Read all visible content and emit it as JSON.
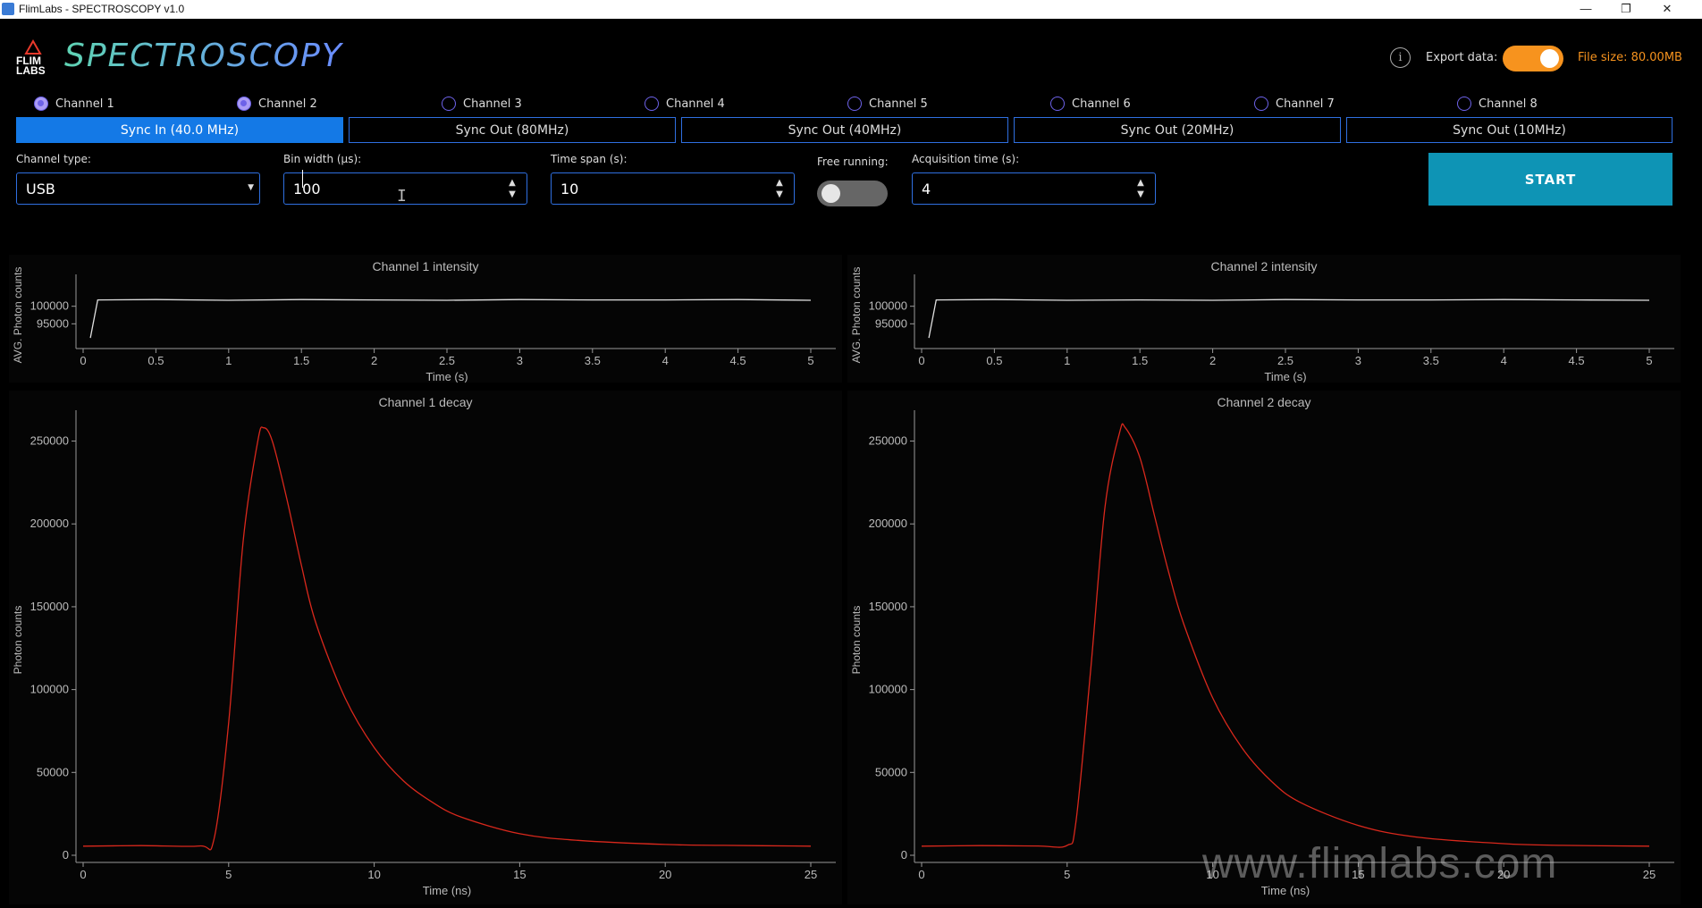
{
  "window": {
    "title": "FlimLabs - SPECTROSCOPY v1.0",
    "minimize": "—",
    "restore": "❐",
    "close": "✕"
  },
  "header": {
    "app_title": "SPECTROSCOPY",
    "export_label": "Export data:",
    "export_enabled": true,
    "file_size": "File size: 80.00MB",
    "info_glyph": "i"
  },
  "channels": [
    {
      "label": "Channel 1",
      "checked": true
    },
    {
      "label": "Channel 2",
      "checked": true
    },
    {
      "label": "Channel 3",
      "checked": false
    },
    {
      "label": "Channel 4",
      "checked": false
    },
    {
      "label": "Channel 5",
      "checked": false
    },
    {
      "label": "Channel 6",
      "checked": false
    },
    {
      "label": "Channel 7",
      "checked": false
    },
    {
      "label": "Channel 8",
      "checked": false
    }
  ],
  "sync": [
    {
      "label": "Sync In (40.0 MHz)",
      "active": true
    },
    {
      "label": "Sync Out (80MHz)",
      "active": false
    },
    {
      "label": "Sync Out (40MHz)",
      "active": false
    },
    {
      "label": "Sync Out (20MHz)",
      "active": false
    },
    {
      "label": "Sync Out (10MHz)",
      "active": false
    }
  ],
  "controls": {
    "channel_type_label": "Channel type:",
    "channel_type_value": "USB",
    "bin_width_label": "Bin width (µs):",
    "bin_width_value": "100",
    "time_span_label": "Time span (s):",
    "time_span_value": "10",
    "free_running_label": "Free running:",
    "free_running": false,
    "acq_time_label": "Acquisition time (s):",
    "acq_time_value": "4",
    "start_label": "START"
  },
  "colors": {
    "accent_blue": "#1479e6",
    "export_orange": "#f7931e",
    "start_teal": "#0e94b5",
    "decay_red": "#d9281c",
    "intensity_line": "#e0e0e0"
  },
  "watermark": "www.flimlabs.com",
  "chart_data": [
    {
      "type": "line",
      "title": "Channel 1 intensity",
      "xlabel": "Time (s)",
      "ylabel": "AVG. Photon counts",
      "xlim": [
        0,
        5
      ],
      "ylim": [
        90000,
        105000
      ],
      "xticks": [
        "0",
        "0.5",
        "1",
        "1.5",
        "2",
        "2.5",
        "3",
        "3.5",
        "4",
        "4.5",
        "5"
      ],
      "yticks": [
        "95000",
        "100000"
      ],
      "series": [
        {
          "x": [
            0.05,
            0.1,
            0.5,
            1,
            1.5,
            2,
            2.5,
            3,
            3.5,
            4,
            4.5,
            5
          ],
          "y": [
            91000,
            101800,
            101900,
            101700,
            101900,
            101800,
            101700,
            101900,
            101800,
            101800,
            101900,
            101700
          ]
        }
      ]
    },
    {
      "type": "line",
      "title": "Channel 2 intensity",
      "xlabel": "Time (s)",
      "ylabel": "AVG. Photon counts",
      "xlim": [
        0,
        5
      ],
      "ylim": [
        90000,
        105000
      ],
      "xticks": [
        "0",
        "0.5",
        "1",
        "1.5",
        "2",
        "2.5",
        "3",
        "3.5",
        "4",
        "4.5",
        "5"
      ],
      "yticks": [
        "95000",
        "100000"
      ],
      "series": [
        {
          "x": [
            0.05,
            0.1,
            0.5,
            1,
            1.5,
            2,
            2.5,
            3,
            3.5,
            4,
            4.5,
            5
          ],
          "y": [
            91000,
            101800,
            101900,
            101700,
            101800,
            101700,
            101900,
            101800,
            101800,
            101900,
            101800,
            101700
          ]
        }
      ]
    },
    {
      "type": "line",
      "title": "Channel 1 decay",
      "xlabel": "Time (ns)",
      "ylabel": "Photon counts",
      "xlim": [
        0,
        25
      ],
      "ylim": [
        0,
        260000
      ],
      "xticks": [
        "0",
        "5",
        "10",
        "15",
        "20",
        "25"
      ],
      "yticks": [
        "0",
        "50000",
        "100000",
        "150000",
        "200000",
        "250000"
      ],
      "series": [
        {
          "x": [
            0,
            2,
            4,
            4.5,
            5,
            5.5,
            6,
            6.2,
            6.5,
            7,
            7.5,
            8,
            9,
            10,
            11,
            12,
            13,
            15,
            17,
            20,
            22,
            25
          ],
          "y": [
            5500,
            5800,
            5600,
            10000,
            80000,
            190000,
            250000,
            258000,
            250000,
            215000,
            175000,
            140000,
            95000,
            65000,
            45000,
            32000,
            23000,
            13000,
            9000,
            6500,
            6000,
            5500
          ]
        }
      ]
    },
    {
      "type": "line",
      "title": "Channel 2 decay",
      "xlabel": "Time (ns)",
      "ylabel": "Photon counts",
      "xlim": [
        0,
        25
      ],
      "ylim": [
        0,
        260000
      ],
      "xticks": [
        "0",
        "5",
        "10",
        "15",
        "20",
        "25"
      ],
      "yticks": [
        "0",
        "50000",
        "100000",
        "150000",
        "200000",
        "250000"
      ],
      "series": [
        {
          "x": [
            0,
            2,
            4,
            5,
            5.3,
            5.8,
            6.3,
            6.8,
            7,
            7.5,
            8,
            8.5,
            9,
            10,
            11,
            12,
            13,
            15,
            17,
            20,
            22,
            25
          ],
          "y": [
            5500,
            5800,
            5600,
            6000,
            20000,
            110000,
            210000,
            255000,
            258000,
            240000,
            205000,
            170000,
            140000,
            95000,
            65000,
            45000,
            32000,
            18000,
            11000,
            7000,
            6000,
            5500
          ]
        }
      ]
    }
  ]
}
